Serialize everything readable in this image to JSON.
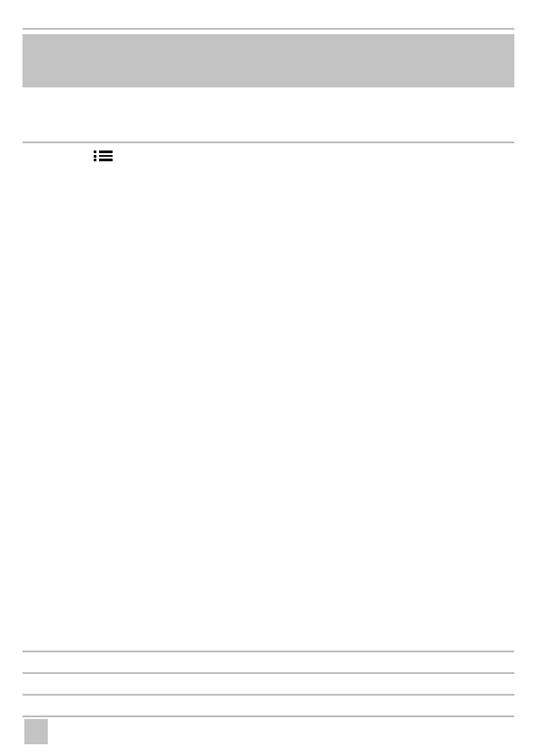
{
  "colors": {
    "band": "#c3c3c3",
    "rule": "#bdbdbd",
    "icon": "#111111",
    "background": "#ffffff"
  },
  "icons": {
    "section": "list-icon"
  }
}
